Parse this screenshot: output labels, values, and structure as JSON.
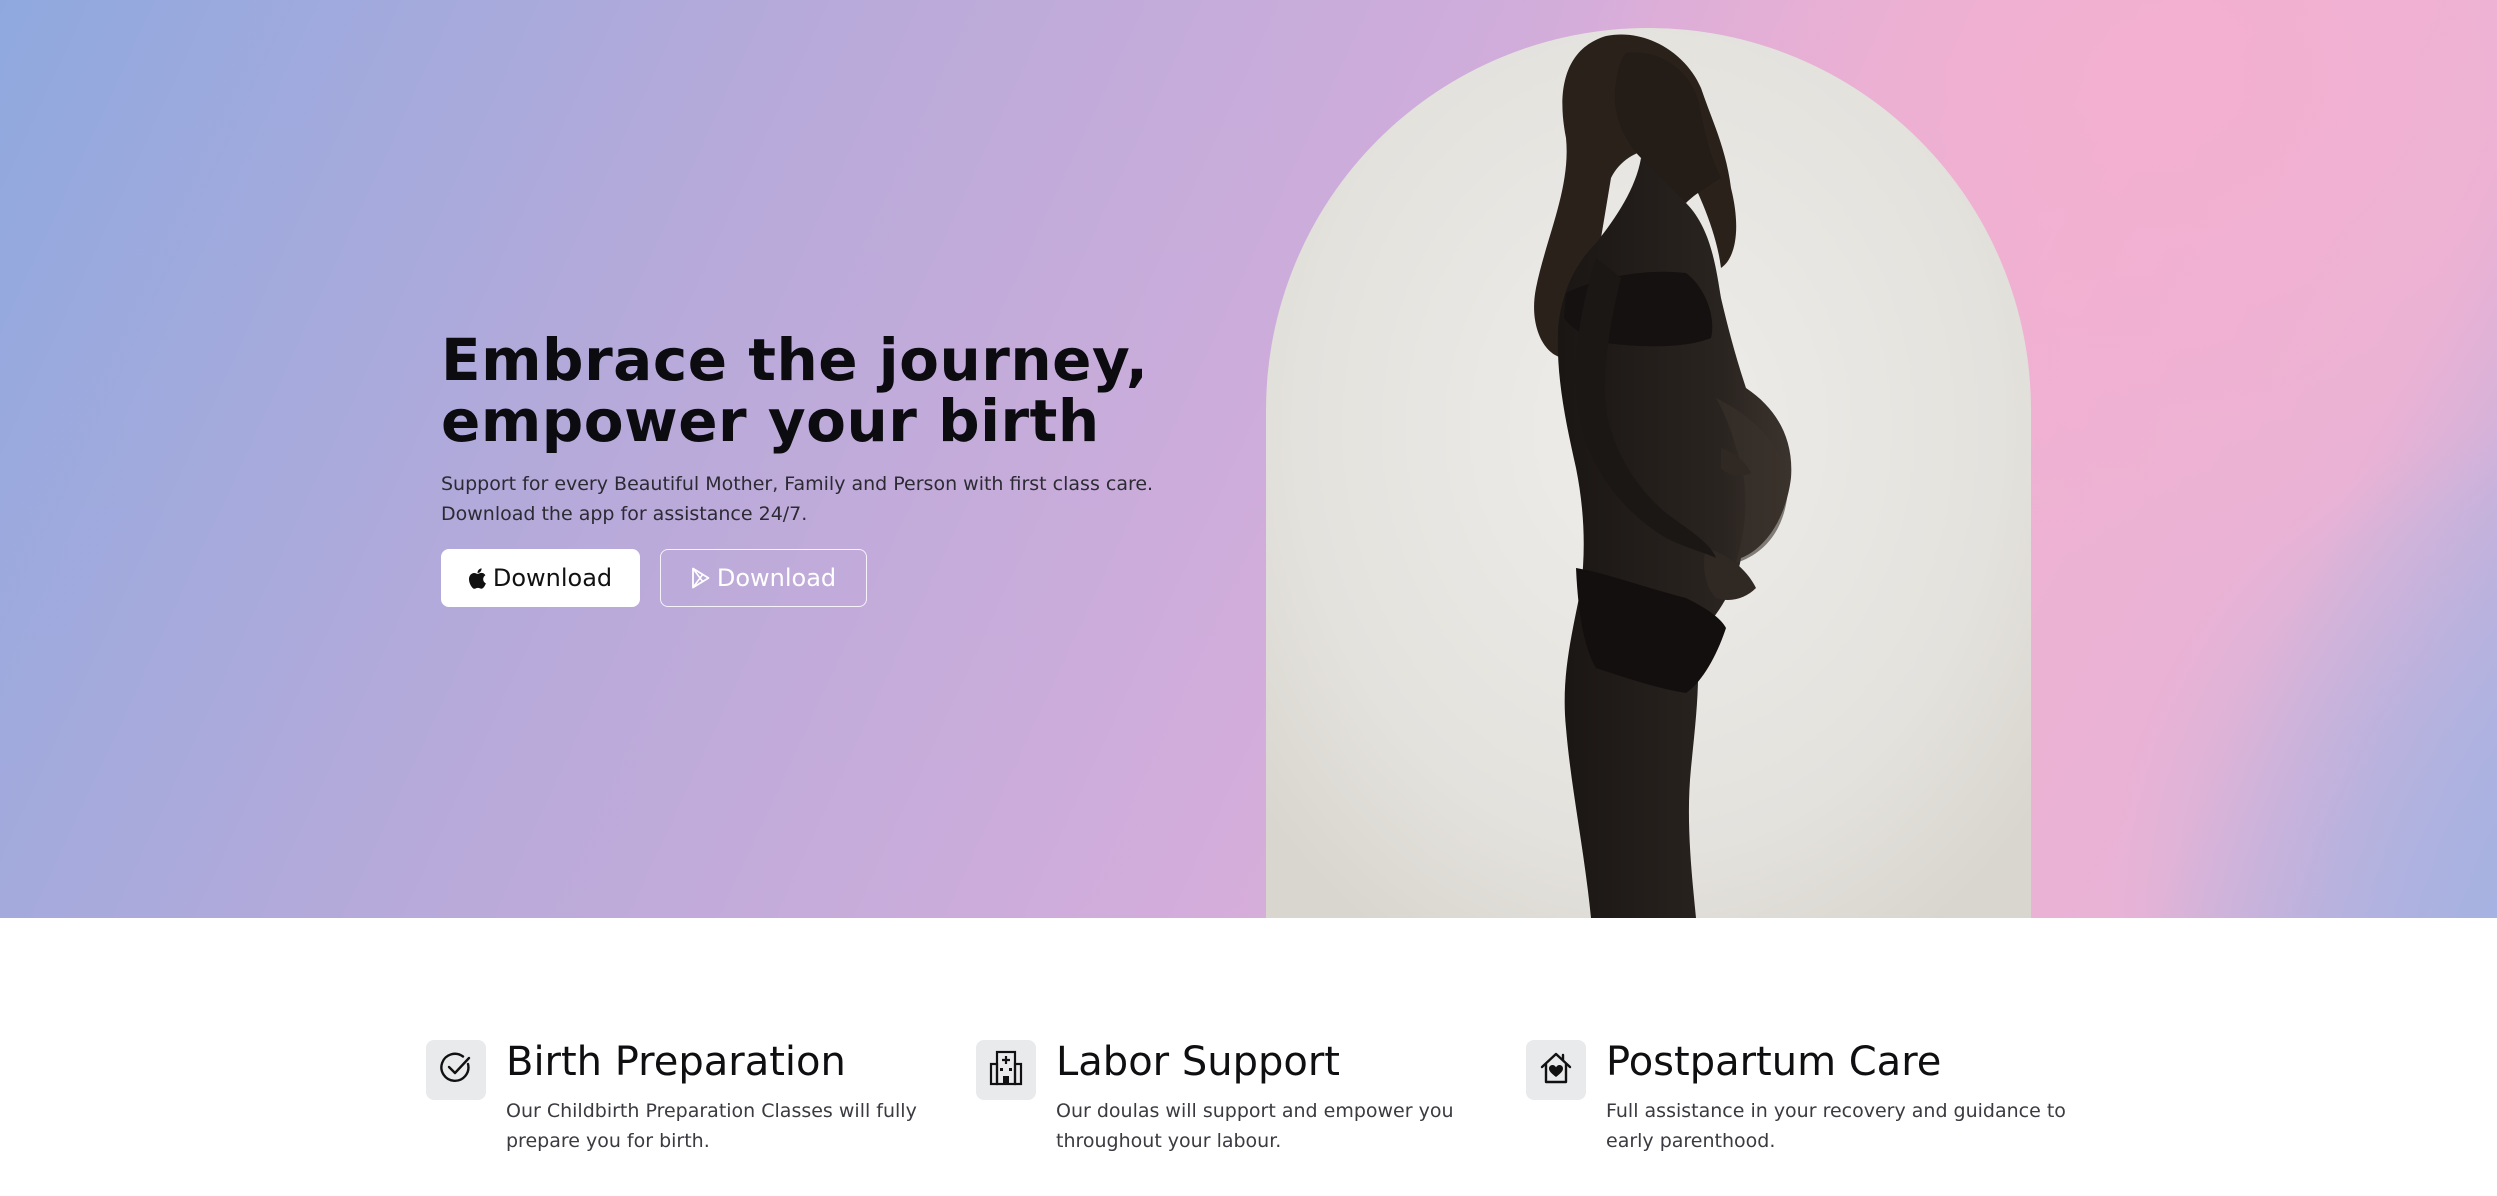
{
  "hero": {
    "title_line1": "Embrace the journey,",
    "title_line2": "empower your birth",
    "subtitle": "Support for every Beautiful Mother, Family and Person with first class care. Download the app for assistance 24/7.",
    "buttons": [
      {
        "icon": "apple-icon",
        "label": "Download"
      },
      {
        "icon": "play-store-icon",
        "label": "Download"
      }
    ]
  },
  "features": [
    {
      "icon": "check-circle-icon",
      "title": "Birth Preparation",
      "text": "Our Childbirth Preparation Classes will fully prepare you for birth."
    },
    {
      "icon": "hospital-icon",
      "title": "Labor Support",
      "text": "Our doulas will support and empower you throughout your labour."
    },
    {
      "icon": "house-heart-icon",
      "title": "Postpartum Care",
      "text": "Full assistance in your recovery and guidance to early parenthood."
    }
  ],
  "colors": {
    "gradient_blue": "#8fa9df",
    "gradient_pink": "#efb1d3",
    "title": "#0b0b10",
    "icon_tile": "#e9eaec"
  }
}
